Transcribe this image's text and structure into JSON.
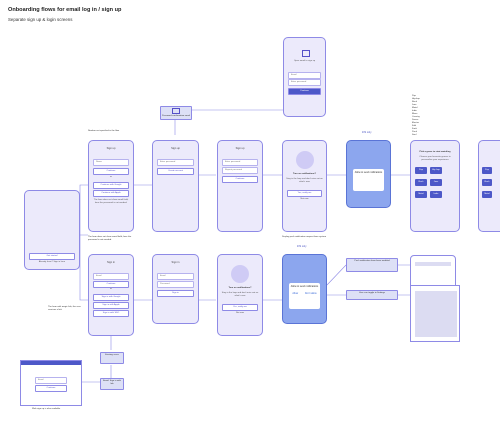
{
  "header": {
    "title": "Onboarding flows for email log in / sign up",
    "subtitle": "Separate sign up & login screens"
  },
  "welcome": {
    "button": "Get started",
    "link": "Already have? Sign in here"
  },
  "signup": {
    "title": "Sign up",
    "name_placeholder": "Name",
    "email_placeholder": "Email",
    "continue": "Continue",
    "or": "or",
    "google": "Continue with Google",
    "apple": "Continue with Apple",
    "note_top": "Number not specified in the flow",
    "note_bottom": "The form does not show email field; here the password is not needed."
  },
  "email_sent": {
    "label": "Email sent",
    "placeholder": "Enter password",
    "button": "Create account"
  },
  "mail_callout": {
    "text": "Password confirmation email"
  },
  "inbox": {
    "title": "Gmail / Apple mail",
    "text": "Open email to sign up"
  },
  "password": {
    "placeholder1": "Enter password",
    "placeholder2": "Repeat password",
    "button": "Continue"
  },
  "notifications": {
    "title": "Turn on notifications?",
    "text": "Stay in the loop and don't miss out on what's new",
    "primary": "Yes, notify me",
    "secondary": "Not now",
    "note": "Display push notification request from system",
    "dialog": "Allow to send notifications",
    "ios_label": "iOS only",
    "allow": "Allow",
    "deny": "Don't allow"
  },
  "topics": {
    "title": "Pick a genre to start watching",
    "subtitle": "Choose your favourite genres to personalize your experience",
    "options": [
      "Pop",
      "Hip hop",
      "Rock",
      "Jazz",
      "Metal",
      "Indie"
    ],
    "labels": [
      "Pop",
      "Hip-hop",
      "Rock",
      "Jazz",
      "Metal",
      "Indie",
      "Blues",
      "Country",
      "Dance",
      "Electro",
      "Folk",
      "Funk",
      "Punk",
      "Soul"
    ]
  },
  "login": {
    "title": "Sign in",
    "email_placeholder": "Email",
    "continue": "Continue",
    "or": "or",
    "google": "Sign in with Google",
    "apple": "Sign in with Apple",
    "sso": "Sign in with SSO",
    "password_placeholder": "Password",
    "button": "Sign in",
    "note": "The form with magic link, the user receives a link"
  },
  "flows": {
    "existing": "Existing users",
    "notif_enabled": "Push notification have been enabled",
    "notif_disabled": "User can toggle in Settings",
    "forgot": "Forgot password?"
  },
  "web": {
    "email_placeholder": "Email",
    "button": "Continue",
    "note": "Web sign up is also available"
  },
  "email_link": {
    "text": "Email: Sign in with link"
  }
}
